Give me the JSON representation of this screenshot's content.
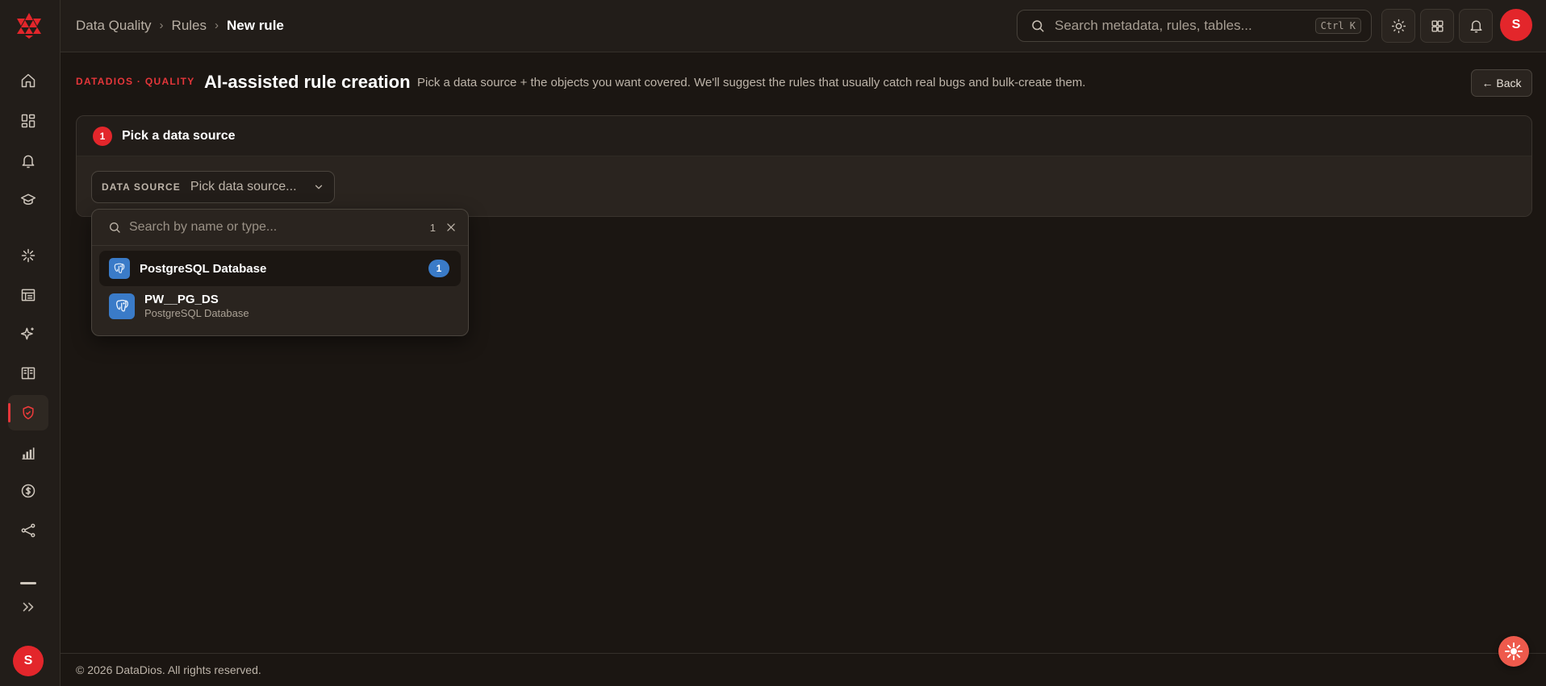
{
  "breadcrumb": {
    "root": "Data Quality",
    "parent": "Rules",
    "current": "New rule"
  },
  "search": {
    "placeholder": "Search metadata, rules, tables...",
    "shortcut": "Ctrl K"
  },
  "user": {
    "initial": "S"
  },
  "page": {
    "eyebrow": "DATADIOS · QUALITY",
    "title": "AI-assisted rule creation",
    "subtitle": "Pick a data source + the objects you want covered. We'll suggest the rules that usually catch real bugs and bulk-create them.",
    "back_label": "← Back"
  },
  "step": {
    "number": "1",
    "title": "Pick a data source",
    "data_source_label": "DATA SOURCE",
    "data_source_value": "Pick data source..."
  },
  "dropdown": {
    "search_placeholder": "Search by name or type...",
    "result_count": "1",
    "group_label": "PostgreSQL Database",
    "group_count": "1",
    "options": [
      {
        "name": "PW__PG_DS",
        "type": "PostgreSQL Database"
      }
    ]
  },
  "footer": {
    "copyright": "© 2026 DataDios. All rights reserved."
  },
  "colors": {
    "accent": "#e3262b",
    "postgres": "#3a7bc8",
    "background": "#1b1612"
  }
}
